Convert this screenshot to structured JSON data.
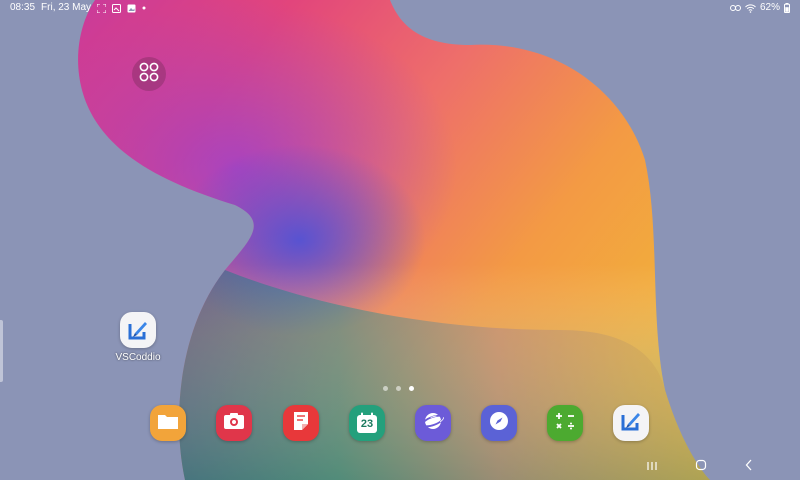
{
  "status_bar": {
    "time": "08:35",
    "date": "Fri, 23 May",
    "battery": "62%",
    "left_icons": [
      "screenshot-icon",
      "gallery-icon",
      "image-icon",
      "dot-icon"
    ],
    "right_icons": [
      "link-icon",
      "wifi-icon",
      "battery-icon"
    ]
  },
  "home": {
    "apps_button_icon": "apps-grid-icon",
    "desktop_shortcuts": [
      {
        "label": "VSCoddio",
        "icon": "vscoddio-icon"
      }
    ],
    "pages": 3,
    "current_page": 3
  },
  "dock": [
    {
      "icon": "my-files-icon",
      "color": "#f2a43a"
    },
    {
      "icon": "camera-icon",
      "color": "#e0364a"
    },
    {
      "icon": "notes-icon",
      "color": "#e8383a"
    },
    {
      "icon": "calendar-icon",
      "color": "#24a07c",
      "text": "23"
    },
    {
      "icon": "internet-icon",
      "color": "#6c5bd8"
    },
    {
      "icon": "compass-icon",
      "color": "#5b62d6"
    },
    {
      "icon": "calculator-icon",
      "color": "#4caa30"
    },
    {
      "icon": "vscoddio-icon",
      "color": "#f4f4f6"
    }
  ],
  "nav_bar": {
    "buttons": [
      "recents-icon",
      "home-icon",
      "back-icon"
    ]
  },
  "colors": {
    "background": "#8b94b6",
    "wallpaper_pink": "#e0407a",
    "wallpaper_orange": "#f2a93b",
    "wallpaper_teal": "#2f8a8a"
  }
}
